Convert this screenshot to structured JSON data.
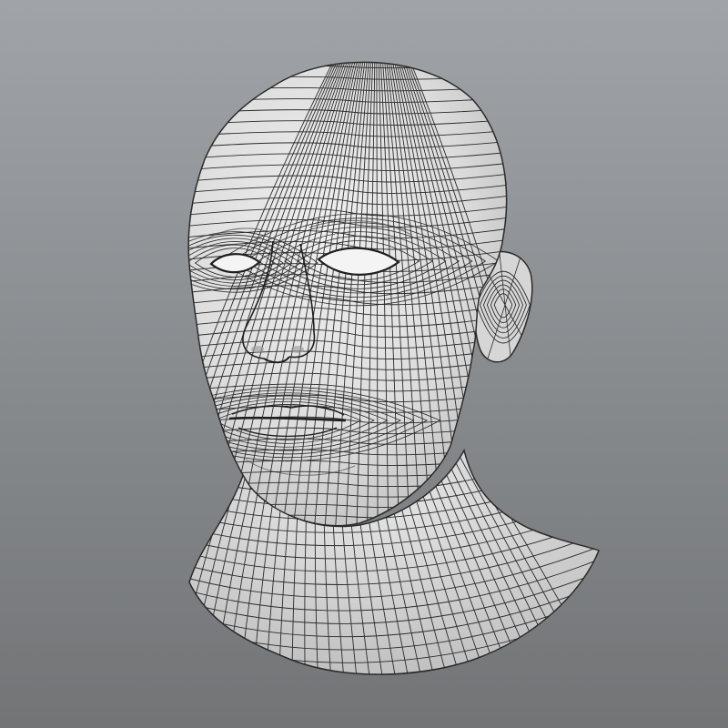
{
  "scene": {
    "subject": "head-bust-wireframe",
    "background": {
      "top_color": "#a0a4a8",
      "bottom_color": "#727476"
    },
    "mesh": {
      "surface_color": "#e8e8e8",
      "shadow_color": "#b8b8b8",
      "wire_color": "#2a2a2a"
    },
    "shading": "smooth",
    "wireframe_overlay": true
  }
}
